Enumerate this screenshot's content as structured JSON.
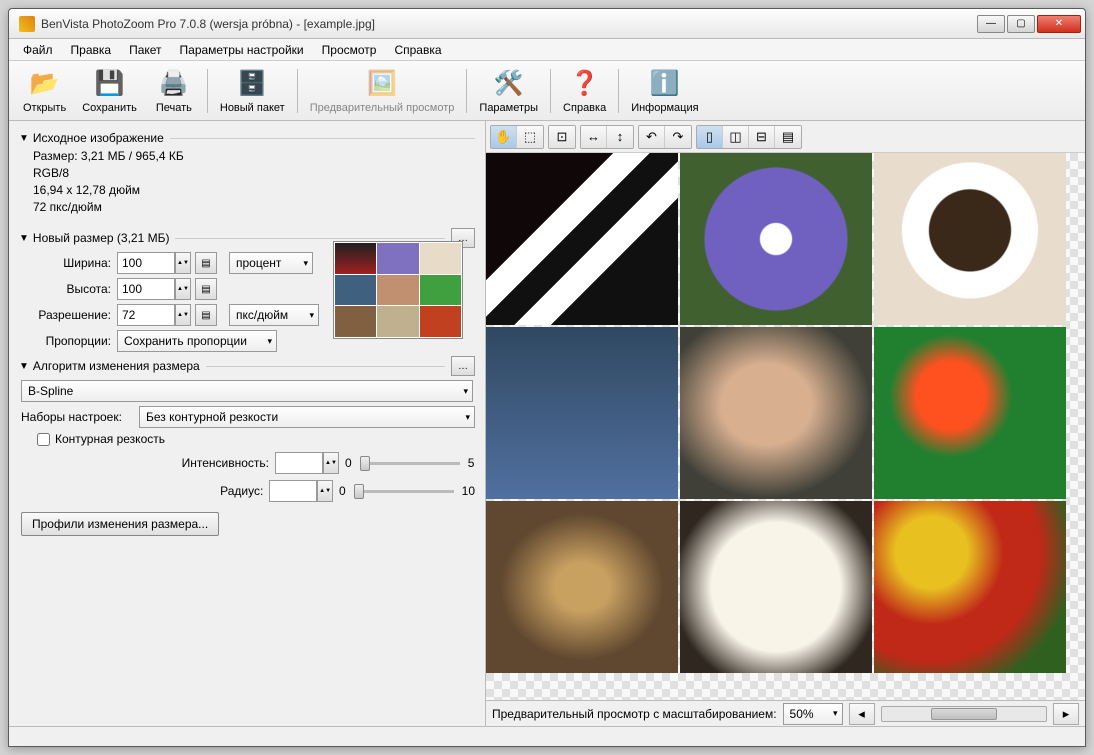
{
  "title": "BenVista PhotoZoom Pro 7.0.8 (wersja próbna) - [example.jpg]",
  "menu": {
    "file": "Файл",
    "edit": "Правка",
    "batch": "Пакет",
    "settings": "Параметры настройки",
    "view": "Просмотр",
    "help": "Справка"
  },
  "toolbar": {
    "open": "Открыть",
    "save": "Сохранить",
    "print": "Печать",
    "newbatch": "Новый пакет",
    "preview": "Предварительный просмотр",
    "params": "Параметры",
    "helpbtn": "Справка",
    "info": "Информация"
  },
  "sections": {
    "source": "Исходное изображение",
    "newsize": "Новый размер (3,21 МБ)",
    "algo": "Алгоритм изменения размера"
  },
  "source": {
    "size": "Размер: 3,21 МБ / 965,4 КБ",
    "mode": "RGB/8",
    "dims": "16,94 x 12,78 дюйм",
    "res": "72 пкс/дюйм"
  },
  "newsize": {
    "width_lbl": "Ширина:",
    "width_val": "100",
    "height_lbl": "Высота:",
    "height_val": "100",
    "unit": "процент",
    "res_lbl": "Разрешение:",
    "res_val": "72",
    "res_unit": "пкс/дюйм",
    "prop_lbl": "Пропорции:",
    "prop_val": "Сохранить пропорции"
  },
  "algo": {
    "method": "B-Spline",
    "presets_lbl": "Наборы настроек:",
    "presets_val": "Без контурной резкости",
    "unsharp": "Контурная резкость",
    "intensity_lbl": "Интенсивность:",
    "intensity_val": "",
    "intensity_min": "0",
    "intensity_max": "5",
    "radius_lbl": "Радиус:",
    "radius_val": "",
    "radius_min": "0",
    "radius_max": "10",
    "profiles_btn": "Профили изменения размера..."
  },
  "preview": {
    "footer_lbl": "Предварительный просмотр с масштабированием:",
    "zoom": "50%"
  }
}
